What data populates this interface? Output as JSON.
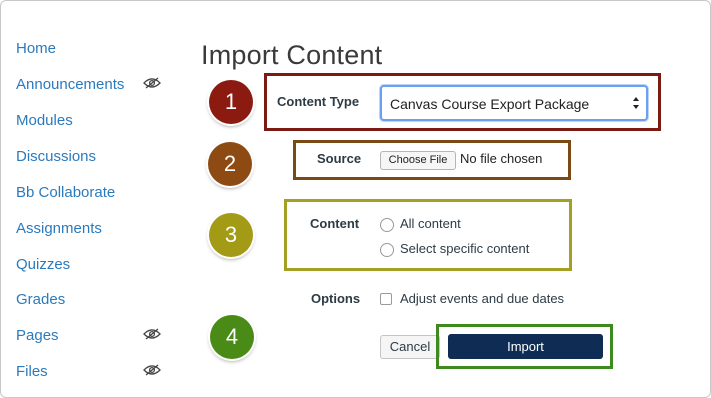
{
  "sidebar": {
    "items": [
      {
        "label": "Home",
        "hidden": false
      },
      {
        "label": "Announcements",
        "hidden": true
      },
      {
        "label": "Modules",
        "hidden": false
      },
      {
        "label": "Discussions",
        "hidden": false
      },
      {
        "label": "Bb Collaborate",
        "hidden": false
      },
      {
        "label": "Assignments",
        "hidden": false
      },
      {
        "label": "Quizzes",
        "hidden": false
      },
      {
        "label": "Grades",
        "hidden": false
      },
      {
        "label": "Pages",
        "hidden": true
      },
      {
        "label": "Files",
        "hidden": true
      }
    ],
    "link_color": "#2b7abc"
  },
  "page": {
    "title": "Import Content"
  },
  "steps": [
    {
      "number": "1",
      "color": "#8b1a10",
      "border": "#7a1a12"
    },
    {
      "number": "2",
      "color": "#8d4a12",
      "border": "#7a4a14"
    },
    {
      "number": "3",
      "color": "#a39a16",
      "border": "#a3a024"
    },
    {
      "number": "4",
      "color": "#4a8a16",
      "border": "#3f8a1e"
    }
  ],
  "form": {
    "content_type": {
      "label": "Content Type",
      "selected": "Canvas Course Export Package"
    },
    "source": {
      "label": "Source",
      "choose_file_label": "Choose File",
      "no_file_text": "No file chosen"
    },
    "content": {
      "label": "Content",
      "options": [
        "All content",
        "Select specific content"
      ]
    },
    "options": {
      "label": "Options",
      "checkbox_label": "Adjust events and due dates"
    },
    "cancel_label": "Cancel",
    "import_label": "Import"
  }
}
